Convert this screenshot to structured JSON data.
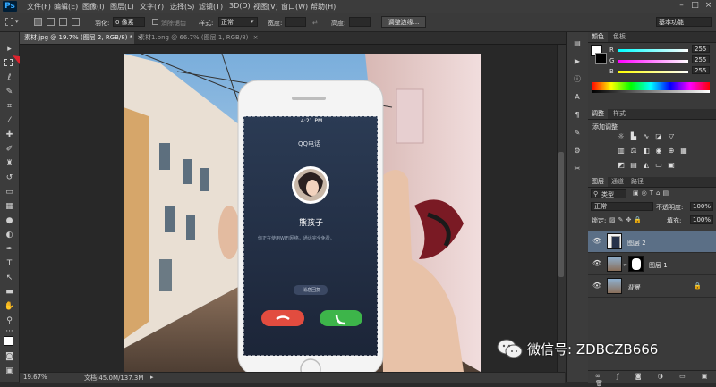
{
  "menubar": {
    "app_logo": "Ps",
    "items": [
      "文件(F)",
      "编辑(E)",
      "图像(I)",
      "图层(L)",
      "文字(Y)",
      "选择(S)",
      "滤镜(T)",
      "3D(D)",
      "视图(V)",
      "窗口(W)",
      "帮助(H)"
    ]
  },
  "options": {
    "feather_label": "羽化:",
    "feather_value": "0 像素",
    "antialias_label": "消除锯齿",
    "style_label": "样式:",
    "style_value": "正常",
    "width_label": "宽度:",
    "height_label": "高度:",
    "refine_edge": "调整边缘...",
    "workspace": "基本功能"
  },
  "tabs": [
    {
      "label": "素材.jpg @ 19.7% (图层 2, RGB/8) *",
      "close": "×"
    },
    {
      "label": "素材1.png @ 66.7% (图层 1, RGB/8)",
      "close": "×"
    }
  ],
  "phone": {
    "time": "4:21 PM",
    "app_title": "QQ电话",
    "caller": "熊孩子",
    "notice": "你正在使用WIFI网络，通话完全免费。",
    "message_btn": "消息回复"
  },
  "statusbar": {
    "zoom": "19.67%",
    "doc_info": "文档:45.0M/137.3M"
  },
  "color_panel": {
    "tabs": [
      "颜色",
      "色板"
    ],
    "channels": [
      {
        "label": "R",
        "value": "255"
      },
      {
        "label": "G",
        "value": "255"
      },
      {
        "label": "B",
        "value": "255"
      }
    ]
  },
  "adjust_panel": {
    "tabs": [
      "调整",
      "样式"
    ],
    "title": "添加调整"
  },
  "layers_panel": {
    "tabs": [
      "图层",
      "通道",
      "路径"
    ],
    "filter_label": "类型",
    "blend_mode": "正常",
    "opacity_label": "不透明度:",
    "opacity_value": "100%",
    "lock_label": "锁定:",
    "fill_label": "填充:",
    "fill_value": "100%",
    "layers": [
      {
        "name": "图层 2"
      },
      {
        "name": "图层 1"
      },
      {
        "name": "背景"
      }
    ]
  },
  "watermark": {
    "text": "微信号: ZDBCZB666"
  },
  "colors": {
    "accent": "#e0232e",
    "decline": "#e24c3f",
    "accept": "#3db54a",
    "selected_layer": "#5b6f86"
  }
}
